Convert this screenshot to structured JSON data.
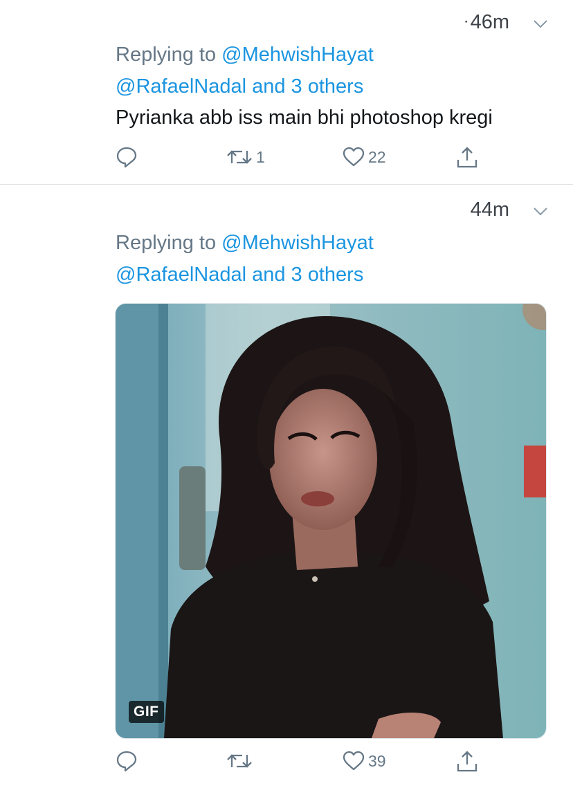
{
  "tweets": [
    {
      "time": "46m",
      "replying_prefix": "Replying to ",
      "reply_to": "@MehwishHayat",
      "also_replying": "@RafaelNadal and 3 others",
      "text": "Pyrianka abb iss main bhi photoshop kregi",
      "retweets": "1",
      "likes": "22"
    },
    {
      "time": "44m",
      "replying_prefix": "Replying to ",
      "reply_to": "@MehwishHayat",
      "also_replying": "@RafaelNadal and 3 others",
      "media_badge": "GIF",
      "retweets": "",
      "likes": "39"
    }
  ],
  "icons": [
    "caret-down-icon",
    "reply-icon",
    "retweet-icon",
    "like-icon",
    "share-icon"
  ],
  "colors": {
    "mention": "#1b95e0",
    "muted": "#657786",
    "text": "#14171a",
    "divider": "#dfe3e6"
  }
}
